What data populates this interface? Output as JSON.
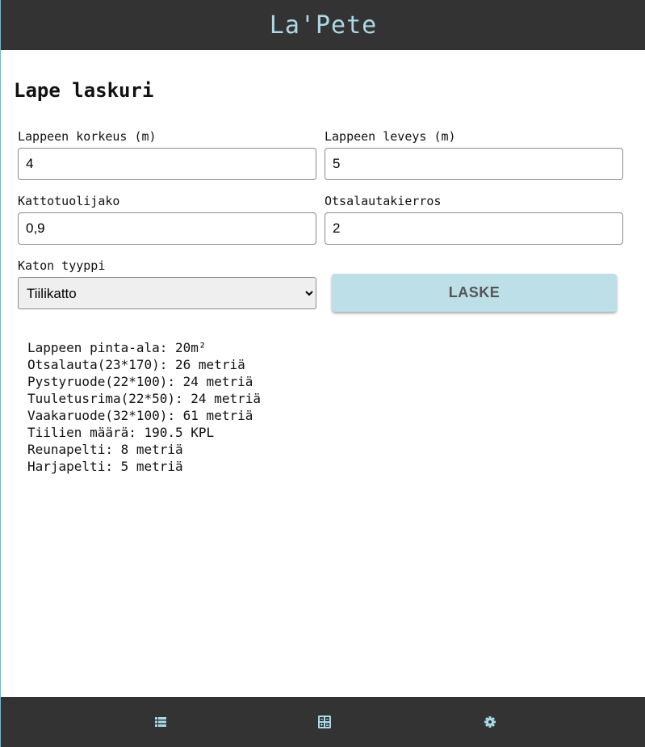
{
  "header": {
    "title": "La'Pete"
  },
  "page": {
    "title": "Lape laskuri"
  },
  "form": {
    "height": {
      "label": "Lappeen korkeus (m)",
      "value": "4"
    },
    "width": {
      "label": "Lappeen leveys (m)",
      "value": "5"
    },
    "rafter_spacing": {
      "label": "Kattotuolijako",
      "value": "0,9"
    },
    "fascia_rounds": {
      "label": "Otsalautakierros",
      "value": "2"
    },
    "roof_type": {
      "label": "Katon tyyppi",
      "selected": "Tiilikatto"
    },
    "calculate_label": "LASKE"
  },
  "results": [
    "Lappeen pinta-ala: 20m²",
    "Otsalauta(23*170): 26 metriä",
    "Pystyruode(22*100): 24 metriä",
    "Tuuletusrima(22*50): 24 metriä",
    "Vaakaruode(32*100): 61 metriä",
    "Tiilien määrä: 190.5 KPL",
    "Reunapelti: 8 metriä",
    "Harjapelti: 5 metriä"
  ],
  "bottom_nav": {
    "items": [
      {
        "icon": "list-icon"
      },
      {
        "icon": "calculator-icon"
      },
      {
        "icon": "gear-icon"
      }
    ]
  },
  "colors": {
    "bar_background": "#333333",
    "title_color": "#add8e6",
    "button_background": "#bde0e8",
    "icon_color": "#a8dcea"
  }
}
